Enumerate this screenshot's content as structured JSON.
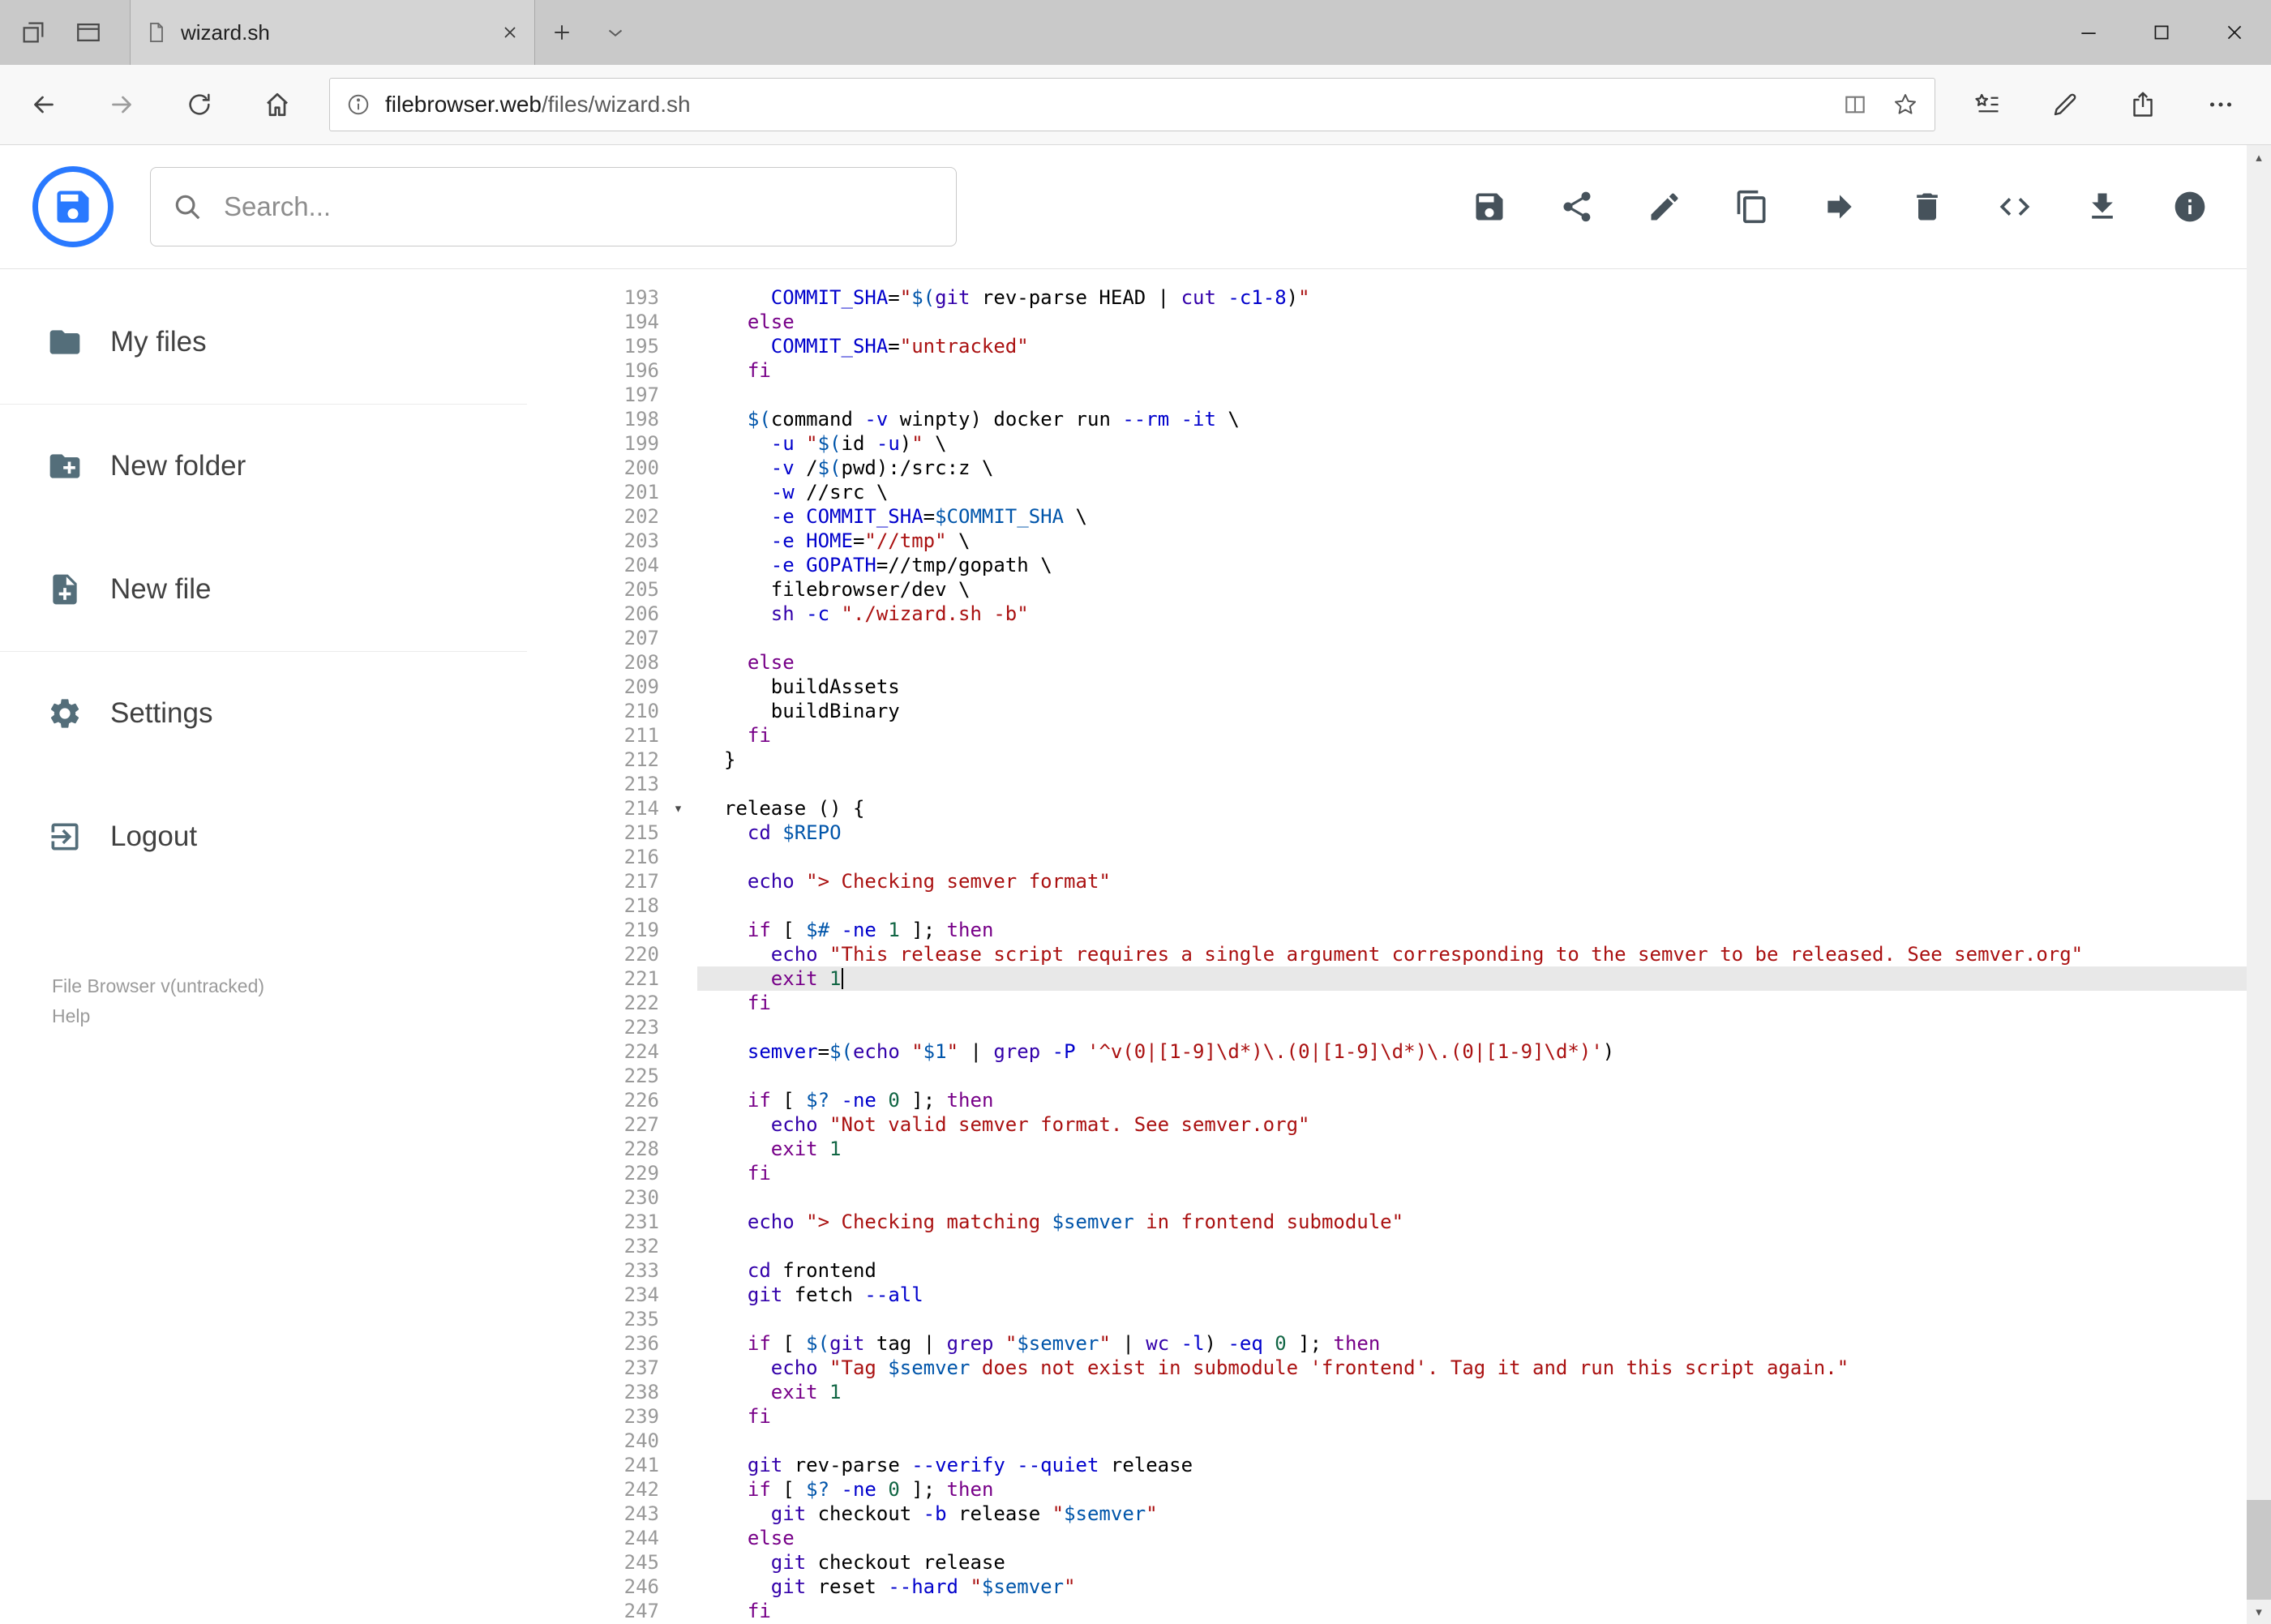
{
  "colors": {
    "accent_blue": "#2979ff",
    "active_line_bg": "#e8e8e8",
    "syntax": {
      "plain": "#000000",
      "keyword": "#770088",
      "builtin": "#3300aa",
      "string": "#aa1111",
      "variable": "#0055aa",
      "def": "#0000cc",
      "attribute": "#0000cc",
      "number": "#116644"
    }
  },
  "browser": {
    "tab": {
      "title": "wizard.sh"
    },
    "url": {
      "domain": "filebrowser.web",
      "path": "/files/wizard.sh"
    },
    "nav_icons": [
      "back",
      "forward",
      "refresh",
      "home"
    ],
    "address_icons": [
      "site-info",
      "reading-view",
      "favorite-star"
    ],
    "right_icons": [
      "hub",
      "ink-notes",
      "share",
      "more"
    ],
    "window_controls": [
      "minimize",
      "maximize",
      "close"
    ]
  },
  "app": {
    "search": {
      "placeholder": "Search..."
    },
    "toolbar_icons": [
      "save",
      "share",
      "edit",
      "copy",
      "move",
      "delete",
      "code",
      "download",
      "info"
    ],
    "sidebar": {
      "items": [
        {
          "label": "My files",
          "icon": "folder-icon"
        },
        {
          "label": "New folder",
          "icon": "new-folder-icon"
        },
        {
          "label": "New file",
          "icon": "new-file-icon"
        },
        {
          "label": "Settings",
          "icon": "settings-icon"
        },
        {
          "label": "Logout",
          "icon": "logout-icon"
        }
      ],
      "footer": {
        "version": "File Browser v(untracked)",
        "help": "Help"
      }
    },
    "editor": {
      "language": "shell",
      "first_line_number": 193,
      "active_line_number": 221,
      "fold_open_line": 214,
      "cursor": {
        "line": 221,
        "column": 10
      },
      "lines": [
        "    COMMIT_SHA=\"$(git rev-parse HEAD | cut -c1-8)\"",
        "  else",
        "    COMMIT_SHA=\"untracked\"",
        "  fi",
        "",
        "  $(command -v winpty) docker run --rm -it \\",
        "    -u \"$(id -u)\" \\",
        "    -v /$(pwd):/src:z \\",
        "    -w //src \\",
        "    -e COMMIT_SHA=$COMMIT_SHA \\",
        "    -e HOME=\"//tmp\" \\",
        "    -e GOPATH=//tmp/gopath \\",
        "    filebrowser/dev \\",
        "    sh -c \"./wizard.sh -b\"",
        "",
        "  else",
        "    buildAssets",
        "    buildBinary",
        "  fi",
        "}",
        "",
        "release () {",
        "  cd $REPO",
        "",
        "  echo \"> Checking semver format\"",
        "",
        "  if [ $# -ne 1 ]; then",
        "    echo \"This release script requires a single argument corresponding to the semver to be released. See semver.org\"",
        "    exit 1",
        "  fi",
        "",
        "  semver=$(echo \"$1\" | grep -P '^v(0|[1-9]\\d*)\\.(0|[1-9]\\d*)\\.(0|[1-9]\\d*)')",
        "",
        "  if [ $? -ne 0 ]; then",
        "    echo \"Not valid semver format. See semver.org\"",
        "    exit 1",
        "  fi",
        "",
        "  echo \"> Checking matching $semver in frontend submodule\"",
        "",
        "  cd frontend",
        "  git fetch --all",
        "",
        "  if [ $(git tag | grep \"$semver\" | wc -l) -eq 0 ]; then",
        "    echo \"Tag $semver does not exist in submodule 'frontend'. Tag it and run this script again.\"",
        "    exit 1",
        "  fi",
        "",
        "  git rev-parse --verify --quiet release",
        "  if [ $? -ne 0 ]; then",
        "    git checkout -b release \"$semver\"",
        "  else",
        "    git checkout release",
        "    git reset --hard \"$semver\"",
        "  fi"
      ]
    }
  }
}
